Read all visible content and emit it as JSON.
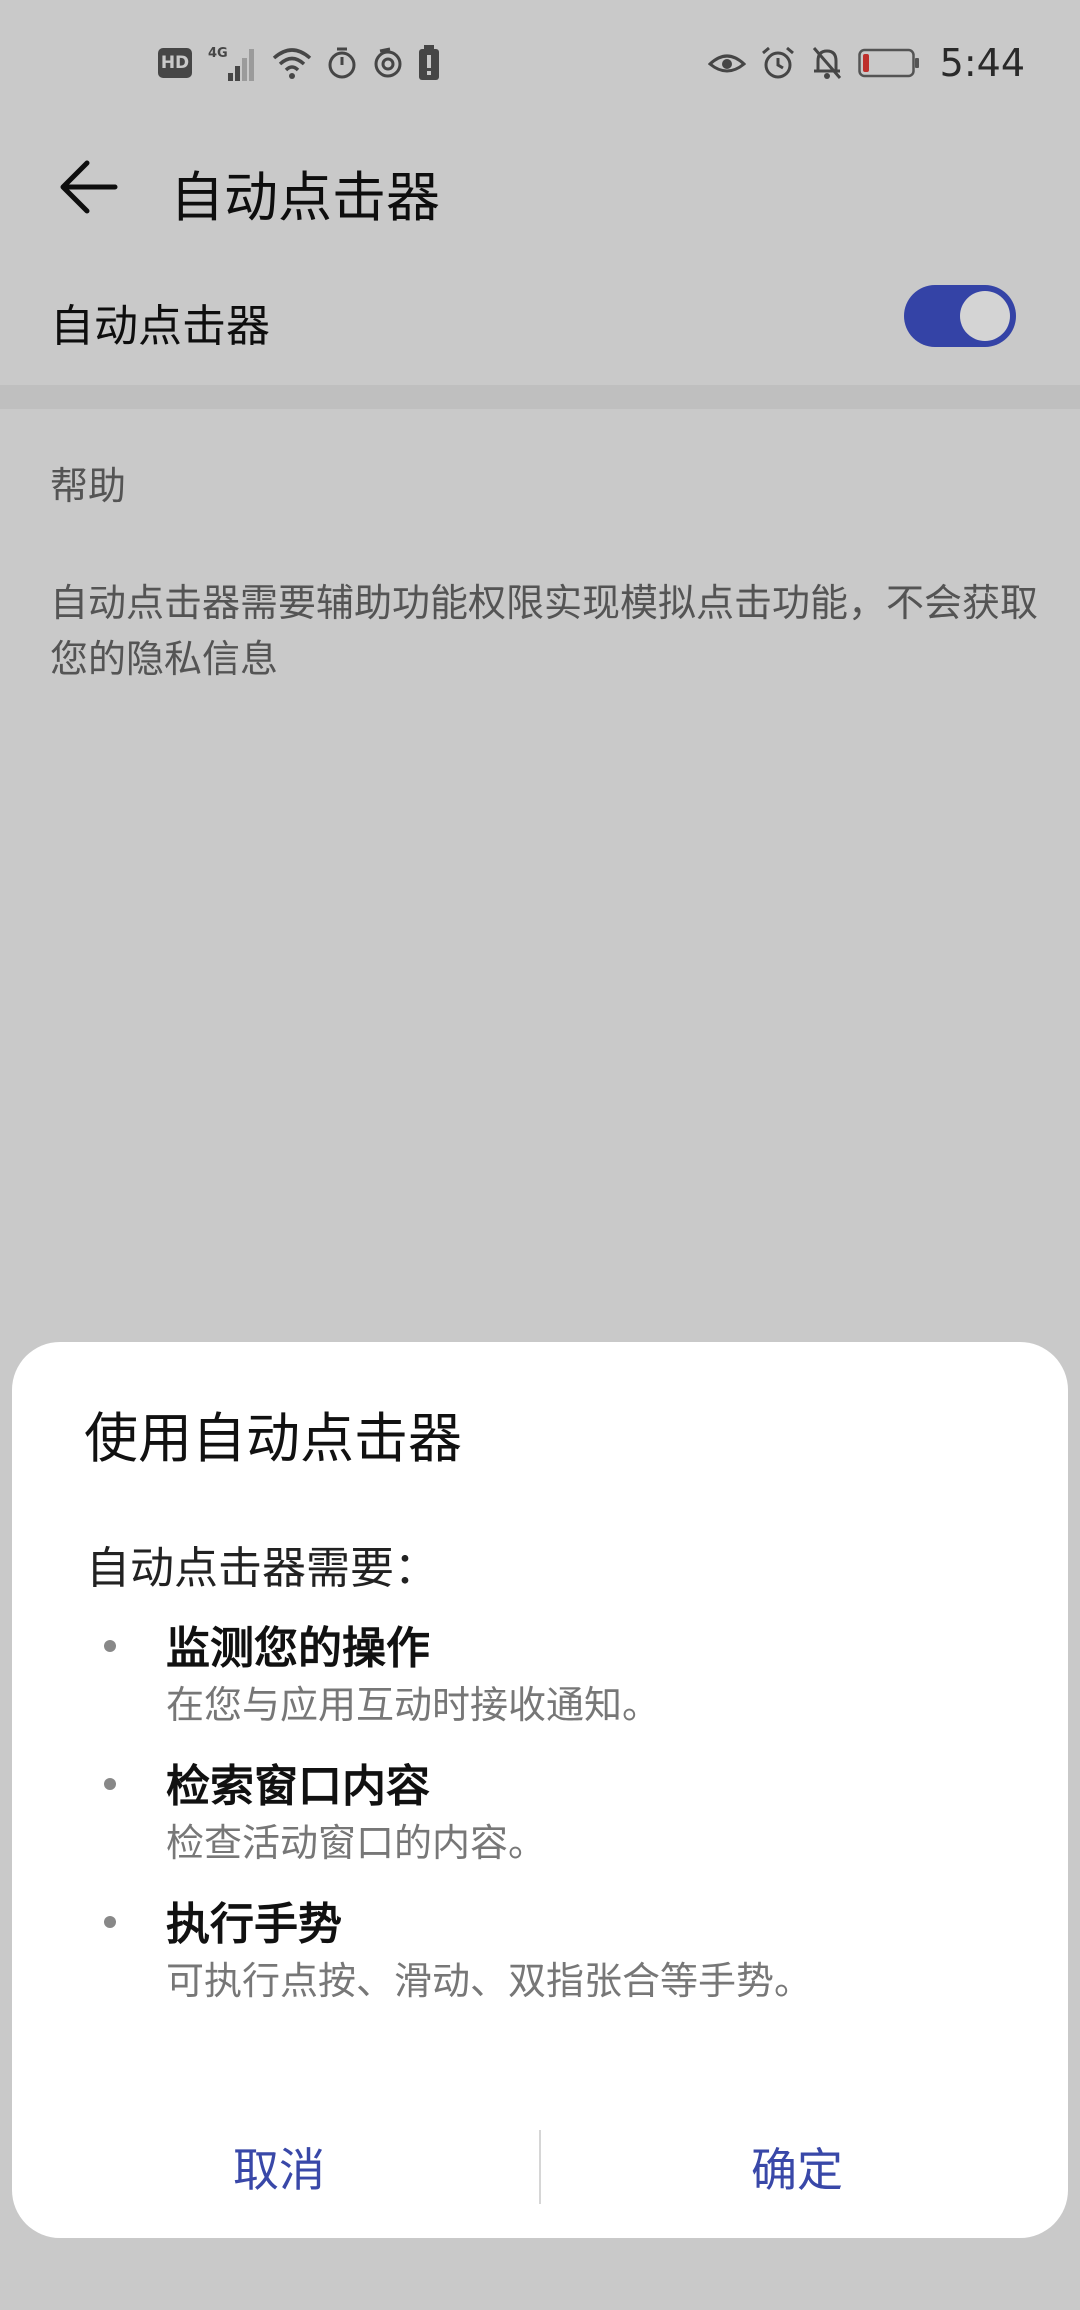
{
  "status_bar": {
    "left_icons": [
      "hd-icon",
      "4g-signal-icon",
      "wifi-icon",
      "timer-icon",
      "sync-icon",
      "battery-saver-icon"
    ],
    "hd_text": "HD",
    "network_text": "4G",
    "right_icons": [
      "eye-icon",
      "alarm-icon",
      "bell-off-icon",
      "battery-icon"
    ],
    "battery_color": "#e53935",
    "time": "5:44"
  },
  "header": {
    "title": "自动点击器"
  },
  "setting": {
    "label": "自动点击器",
    "enabled": true,
    "accent_color": "#3f51c8"
  },
  "help": {
    "header": "帮助",
    "text": "自动点击器需要辅助功能权限实现模拟点击功能，不会获取您的隐私信息"
  },
  "dialog": {
    "title": "使用自动点击器",
    "intro": "自动点击器需要：",
    "permissions": [
      {
        "title": "监测您的操作",
        "desc": "在您与应用互动时接收通知。"
      },
      {
        "title": "检索窗口内容",
        "desc": "检查活动窗口的内容。"
      },
      {
        "title": "执行手势",
        "desc": "可执行点按、滑动、双指张合等手势。"
      }
    ],
    "cancel_label": "取消",
    "confirm_label": "确定",
    "action_color": "#3948a8"
  }
}
